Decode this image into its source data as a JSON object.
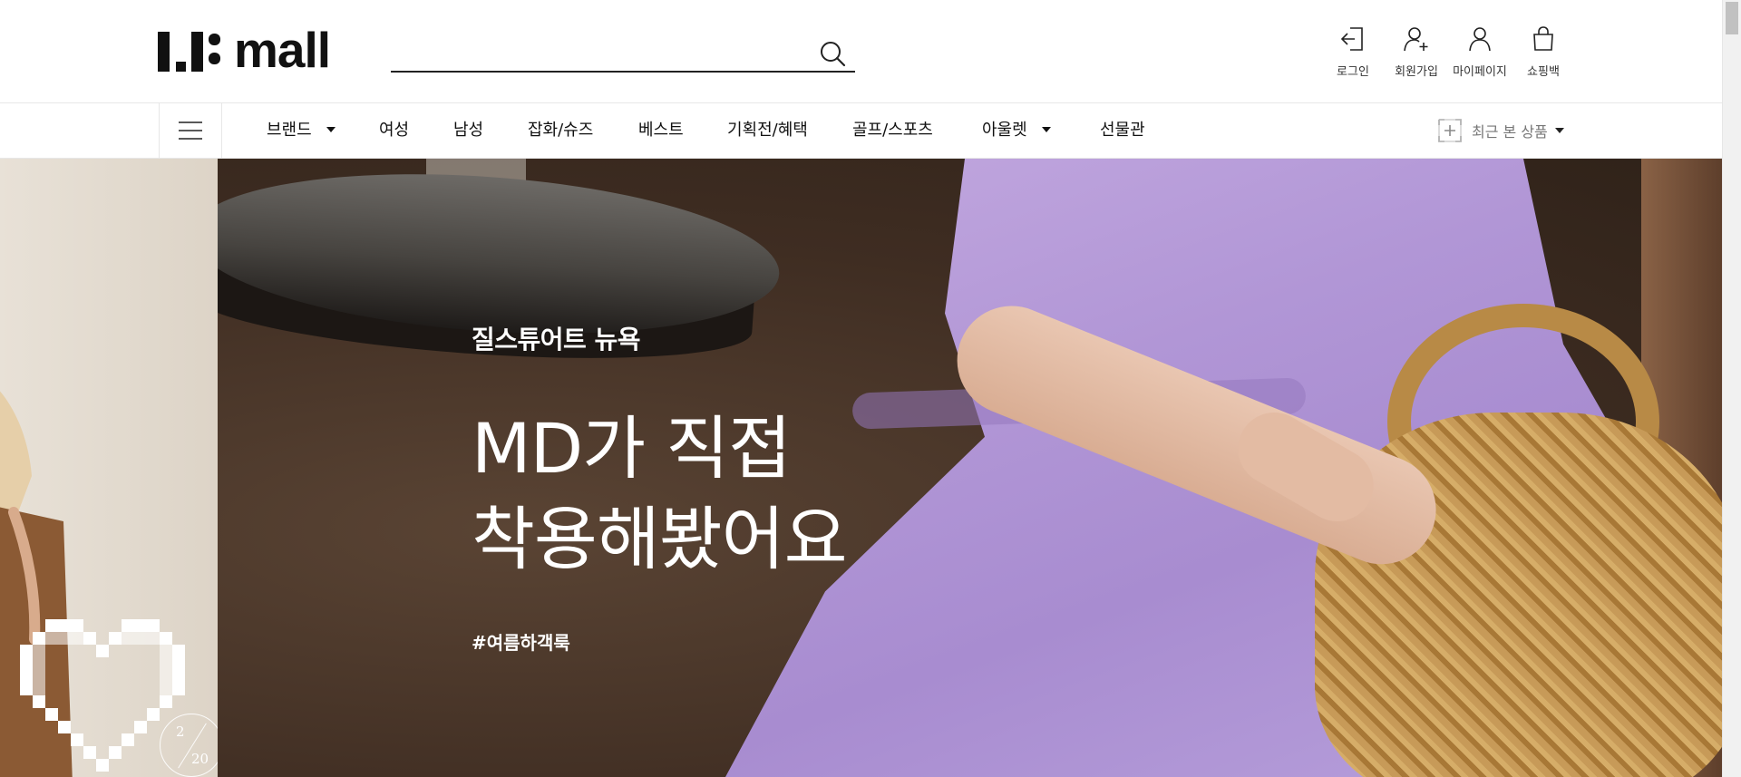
{
  "header": {
    "logo": {
      "text": "mall",
      "mark": "LF"
    },
    "search": {
      "placeholder": "",
      "value": "",
      "icon": "search-icon"
    },
    "utilities": [
      {
        "label": "로그인",
        "icon": "login-icon"
      },
      {
        "label": "회원가입",
        "icon": "user-add-icon"
      },
      {
        "label": "마이페이지",
        "icon": "user-icon"
      },
      {
        "label": "쇼핑백",
        "icon": "shopping-bag-icon"
      }
    ]
  },
  "gnb": {
    "menu_icon": "hamburger-icon",
    "items": [
      {
        "label": "브랜드",
        "has_dropdown": true
      },
      {
        "label": "여성",
        "has_dropdown": false
      },
      {
        "label": "남성",
        "has_dropdown": false
      },
      {
        "label": "잡화/슈즈",
        "has_dropdown": false
      },
      {
        "label": "베스트",
        "has_dropdown": false
      },
      {
        "label": "기획전/혜택",
        "has_dropdown": false
      },
      {
        "label": "골프/스포츠",
        "has_dropdown": false
      },
      {
        "label": "아울렛",
        "has_dropdown": true
      },
      {
        "label": "선물관",
        "has_dropdown": false
      }
    ],
    "recent": {
      "label": "최근 본 상품",
      "icon": "recent-products-icon"
    }
  },
  "hero": {
    "brand": "질스튜어트 뉴욕",
    "title_lines": [
      "MD가 직접",
      "착용해봤어요"
    ],
    "hashtag": "#여름하객룩",
    "slide": {
      "current": "2",
      "total": "20"
    }
  },
  "colors": {
    "text": "#111111",
    "border": "#e7e7e7",
    "hero_text": "#ffffff",
    "dress_lavender": "#b196d6",
    "background_brown": "#3f2d22"
  }
}
